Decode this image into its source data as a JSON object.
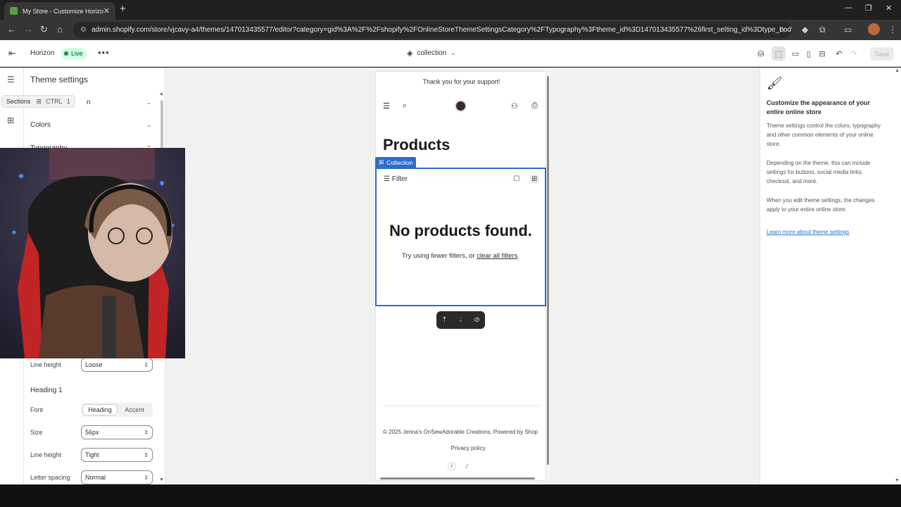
{
  "browser": {
    "tab_title": "My Store - Customize Horizon",
    "tab_close": "✕",
    "new_tab": "+",
    "url": "admin.shopify.com/store/vjcavy-a4/themes/147013435577/editor?category=gid%3A%2F%2Fshopify%2FOnlineStoreThemeSettingsCategory%2FTypography%3Ftheme_id%3D147013435577%26first_setting_id%3Dtype_body_font&pre...",
    "min": "—",
    "restore": "❐",
    "close": "✕"
  },
  "shopify_bar": {
    "theme_name": "Horizon",
    "live_label": "Live",
    "more": "•••",
    "template": "collection",
    "save_label": "Save"
  },
  "left": {
    "title": "Theme settings",
    "tooltip": {
      "label": "Sections",
      "key1": "CTRL",
      "key2": "1"
    },
    "acc_partial": "n",
    "colors": "Colors",
    "typography": "Typography",
    "line_height_label": "Line height",
    "line_height_value": "Loose",
    "heading1": "Heading 1",
    "font_label": "Font",
    "font_opt1": "Heading",
    "font_opt2": "Accent",
    "size_label": "Size",
    "size_value": "56px",
    "h_line_height_label": "Line height",
    "h_line_height_value": "Tight",
    "letter_spacing_label": "Letter spacing",
    "letter_spacing_value": "Normal"
  },
  "preview": {
    "announcement": "Thank you for your support!",
    "page_title": "Products",
    "section_tag": "Collection",
    "filter_label": "Filter",
    "empty_title": "No products found.",
    "try_text": "Try using fewer filters, or ",
    "clear_link": "clear all filters",
    "try_end": ".",
    "copyright": "© 2025 Jenna's OnSewAdorable Creations, Powered by Shop",
    "privacy": "Privacy policy"
  },
  "right": {
    "heading": "Customize the appearance of your entire online store",
    "p1": "Theme settings control the colors, typography and other common elements of your online store.",
    "p2": "Depending on the theme, this can include settings for buttons, social media links, checkout, and more.",
    "p3": "When you edit theme settings, the changes apply to your entire online store.",
    "link": "Learn more about theme settings"
  },
  "colors": {
    "accent": "#2c6ecb",
    "live_badge": "#cdfee1"
  }
}
